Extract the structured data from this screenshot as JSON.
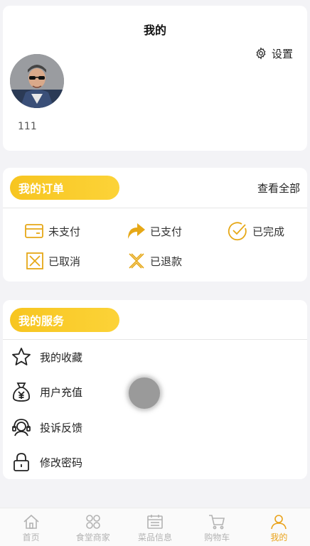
{
  "header": {
    "title": "我的",
    "settings_label": "设置"
  },
  "profile": {
    "username": "111"
  },
  "orders": {
    "section_title": "我的订单",
    "view_all_label": "查看全部",
    "items": [
      {
        "label": "未支付",
        "icon": "card-icon"
      },
      {
        "label": "已支付",
        "icon": "forward-arrow-icon"
      },
      {
        "label": "已完成",
        "icon": "check-circle-icon"
      },
      {
        "label": "已取消",
        "icon": "cancel-box-icon"
      },
      {
        "label": "已退款",
        "icon": "refund-x-icon"
      }
    ]
  },
  "services": {
    "section_title": "我的服务",
    "items": [
      {
        "label": "我的收藏",
        "icon": "star-icon"
      },
      {
        "label": "用户充值",
        "icon": "money-bag-icon"
      },
      {
        "label": "投诉反馈",
        "icon": "headset-icon"
      },
      {
        "label": "修改密码",
        "icon": "lock-icon"
      }
    ]
  },
  "tabbar": {
    "items": [
      {
        "label": "首页",
        "icon": "home-icon"
      },
      {
        "label": "食堂商家",
        "icon": "grid-icon"
      },
      {
        "label": "菜品信息",
        "icon": "calendar-icon"
      },
      {
        "label": "购物车",
        "icon": "cart-icon"
      },
      {
        "label": "我的",
        "icon": "user-icon",
        "active": true
      }
    ]
  },
  "colors": {
    "accent": "#f7c520",
    "active_tab": "#e9a21a",
    "icon_yellow": "#e6a817"
  }
}
